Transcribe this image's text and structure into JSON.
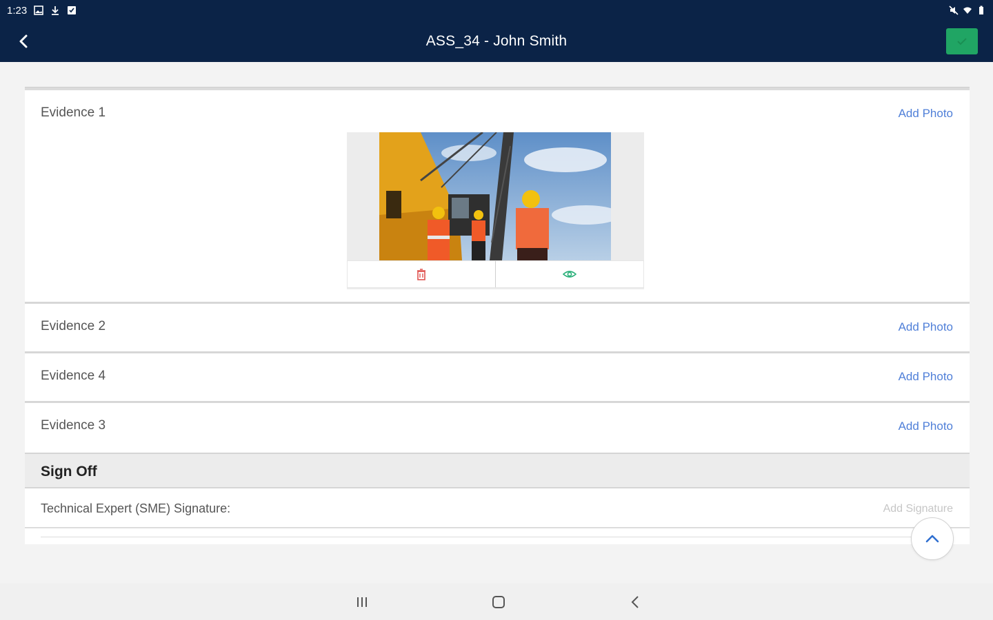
{
  "status_bar": {
    "time": "1:23",
    "left_icons": [
      "gallery-icon",
      "download-icon",
      "sync-icon"
    ],
    "right_icons": [
      "mute-icon",
      "wifi-icon",
      "battery-icon"
    ]
  },
  "app_bar": {
    "title": "ASS_34 - John Smith",
    "back_icon": "back-arrow-icon",
    "save_icon": "check-icon",
    "save_color": "#20a564",
    "background": "#0b2347"
  },
  "evidence": [
    {
      "label": "Evidence 1",
      "action": "Add Photo",
      "has_photo": true,
      "photo_alt": "Construction workers in hard hats beside a crane"
    },
    {
      "label": "Evidence 2",
      "action": "Add Photo",
      "has_photo": false
    },
    {
      "label": "Evidence 4",
      "action": "Add Photo",
      "has_photo": false
    },
    {
      "label": "Evidence 3",
      "action": "Add Photo",
      "has_photo": false
    }
  ],
  "photo_actions": {
    "delete_icon": "trash-icon",
    "view_icon": "eye-icon",
    "delete_color": "#e0524f",
    "view_color": "#2bb07a"
  },
  "sign_off": {
    "title": "Sign Off",
    "signature_label": "Technical Expert (SME) Signature:",
    "signature_action": "Add Signature"
  },
  "scroll_top_icon": "chevron-up-icon",
  "nav_bar": [
    "recents-icon",
    "home-icon",
    "back-icon"
  ],
  "accent_color": "#4f7fd8"
}
